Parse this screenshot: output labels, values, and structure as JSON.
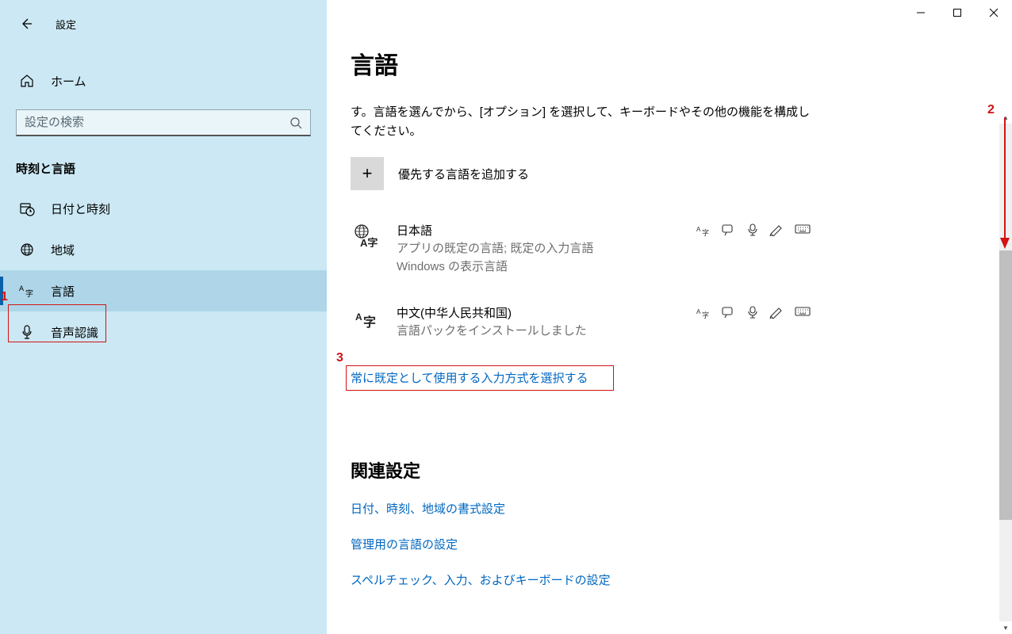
{
  "app": {
    "title": "設定"
  },
  "sidebar": {
    "home": "ホーム",
    "search_placeholder": "設定の検索",
    "category": "時刻と言語",
    "items": [
      {
        "label": "日付と時刻"
      },
      {
        "label": "地域"
      },
      {
        "label": "言語"
      },
      {
        "label": "音声認識"
      }
    ]
  },
  "main": {
    "title": "言語",
    "description": "す。言語を選んでから、[オプション] を選択して、キーボードやその他の機能を構成してください。",
    "add_language": "優先する言語を追加する",
    "languages": [
      {
        "name": "日本語",
        "sub": "アプリの既定の言語; 既定の入力言語\nWindows の表示言語"
      },
      {
        "name": "中文(中华人民共和国)",
        "sub": "言語パックをインストールしました"
      }
    ],
    "default_input_link": "常に既定として使用する入力方式を選択する",
    "related_title": "関連設定",
    "related_links": [
      "日付、時刻、地域の書式設定",
      "管理用の言語の設定",
      "スペルチェック、入力、およびキーボードの設定"
    ]
  },
  "annotations": {
    "n1": "1",
    "n2": "2",
    "n3": "3"
  }
}
